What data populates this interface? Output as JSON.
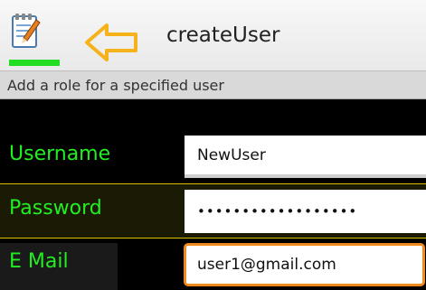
{
  "action_bar": {
    "title": "createUser",
    "app_icon": "notepad-pencil-icon",
    "back_icon": "arrow-left-outline-icon",
    "accent_color": "#22dd22",
    "arrow_color": "#f5b21b"
  },
  "subtitle": "Add a role for a specified user",
  "form": {
    "username": {
      "label": "Username",
      "value": "NewUser"
    },
    "password": {
      "label": "Password",
      "value": "••••••••••••••••••"
    },
    "email": {
      "label": "E Mail",
      "value": "user1@gmail.com"
    },
    "label_color": "#22ee22",
    "focus_color": "#f08a1c"
  }
}
